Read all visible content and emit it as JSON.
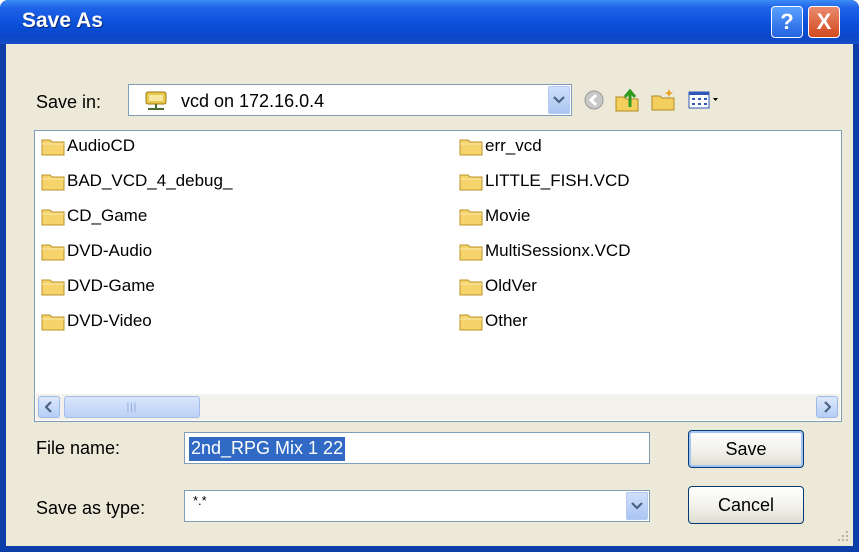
{
  "window": {
    "title": "Save As"
  },
  "title_buttons": {
    "help": "?",
    "close": "X"
  },
  "save_in": {
    "label": "Save in:",
    "value": "vcd on 172.16.0.4"
  },
  "toolbar": {
    "icons": [
      "back-icon",
      "up-folder-icon",
      "new-folder-icon",
      "view-menu-icon"
    ]
  },
  "files": {
    "left": [
      "AudioCD",
      "BAD_VCD_4_debug_",
      "CD_Game",
      "DVD-Audio",
      "DVD-Game",
      "DVD-Video"
    ],
    "right": [
      "err_vcd",
      "LITTLE_FISH.VCD",
      "Movie",
      "MultiSessionx.VCD",
      "OldVer",
      "Other"
    ]
  },
  "file_name": {
    "label": "File name:",
    "value": "2nd_RPG Mix 1 22"
  },
  "save_as_type": {
    "label": "Save as type:",
    "value": "*.*"
  },
  "buttons": {
    "save": "Save",
    "cancel": "Cancel"
  },
  "colors": {
    "titlebar": "#0a4fd8",
    "selection": "#316ac5",
    "folder": "#f6d36b"
  }
}
